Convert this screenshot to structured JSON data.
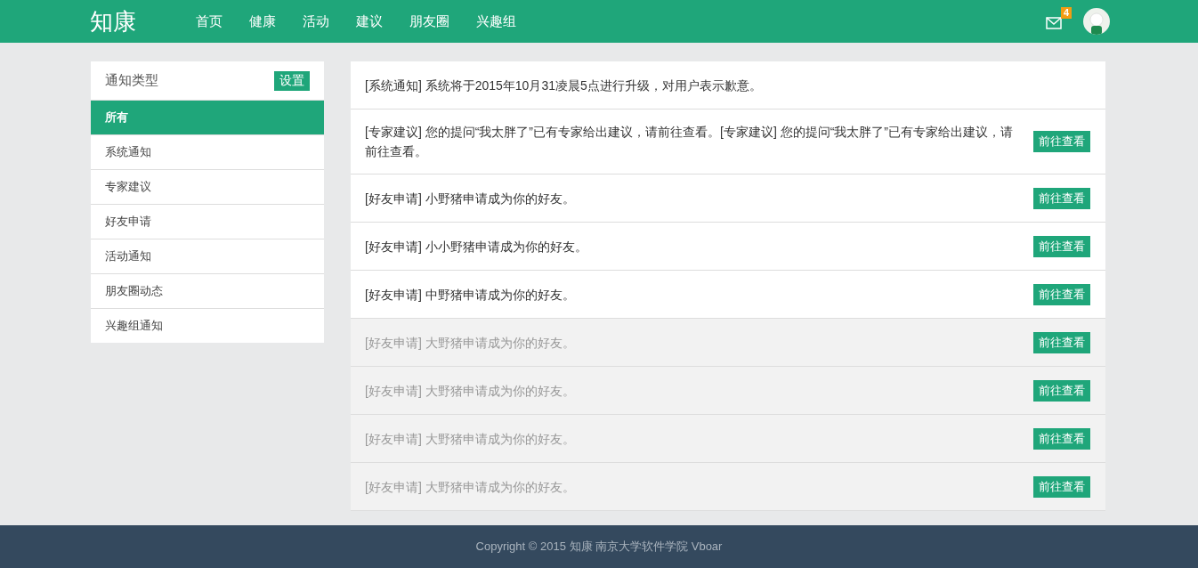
{
  "header": {
    "logo": "知康",
    "nav": [
      {
        "label": "首页",
        "selected": false
      },
      {
        "label": "健康",
        "selected": false
      },
      {
        "label": "活动",
        "selected": false
      },
      {
        "label": "建议",
        "selected": false
      },
      {
        "label": "朋友圈",
        "selected": false
      },
      {
        "label": "兴趣组",
        "selected": false
      }
    ],
    "mail_badge": "4"
  },
  "sidebar": {
    "title": "通知类型",
    "settings_button": "设置",
    "items": [
      {
        "label": "所有",
        "selected": true
      },
      {
        "label": "系统通知",
        "selected": false
      },
      {
        "label": "专家建议",
        "selected": false
      },
      {
        "label": "好友申请",
        "selected": false
      },
      {
        "label": "活动通知",
        "selected": false
      },
      {
        "label": "朋友圈动态",
        "selected": false
      },
      {
        "label": "兴趣组通知",
        "selected": false
      }
    ]
  },
  "notifications": [
    {
      "text": "[系统通知] 系统将于2015年10月31凌晨5点进行升级，对用户表示歉意。",
      "read": false
    },
    {
      "text": "[专家建议] 您的提问“我太胖了”已有专家给出建议，请前往查看。[专家建议] 您的提问“我太胖了”已有专家给出建议，请前往查看。",
      "read": false,
      "action": "前往查看"
    },
    {
      "text": "[好友申请] 小野猪申请成为你的好友。",
      "read": false,
      "action": "前往查看"
    },
    {
      "text": "[好友申请] 小小野猪申请成为你的好友。",
      "read": false,
      "action": "前往查看"
    },
    {
      "text": "[好友申请] 中野猪申请成为你的好友。",
      "read": false,
      "action": "前往查看"
    },
    {
      "text": "[好友申请] 大野猪申请成为你的好友。",
      "read": true,
      "action": "前往查看"
    },
    {
      "text": "[好友申请] 大野猪申请成为你的好友。",
      "read": true,
      "action": "前往查看"
    },
    {
      "text": "[好友申请] 大野猪申请成为你的好友。",
      "read": true,
      "action": "前往查看"
    },
    {
      "text": "[好友申请] 大野猪申请成为你的好友。",
      "read": true,
      "action": "前往查看"
    }
  ],
  "footer": "Copyright © 2015 知康 南京大学软件学院 Vboar"
}
